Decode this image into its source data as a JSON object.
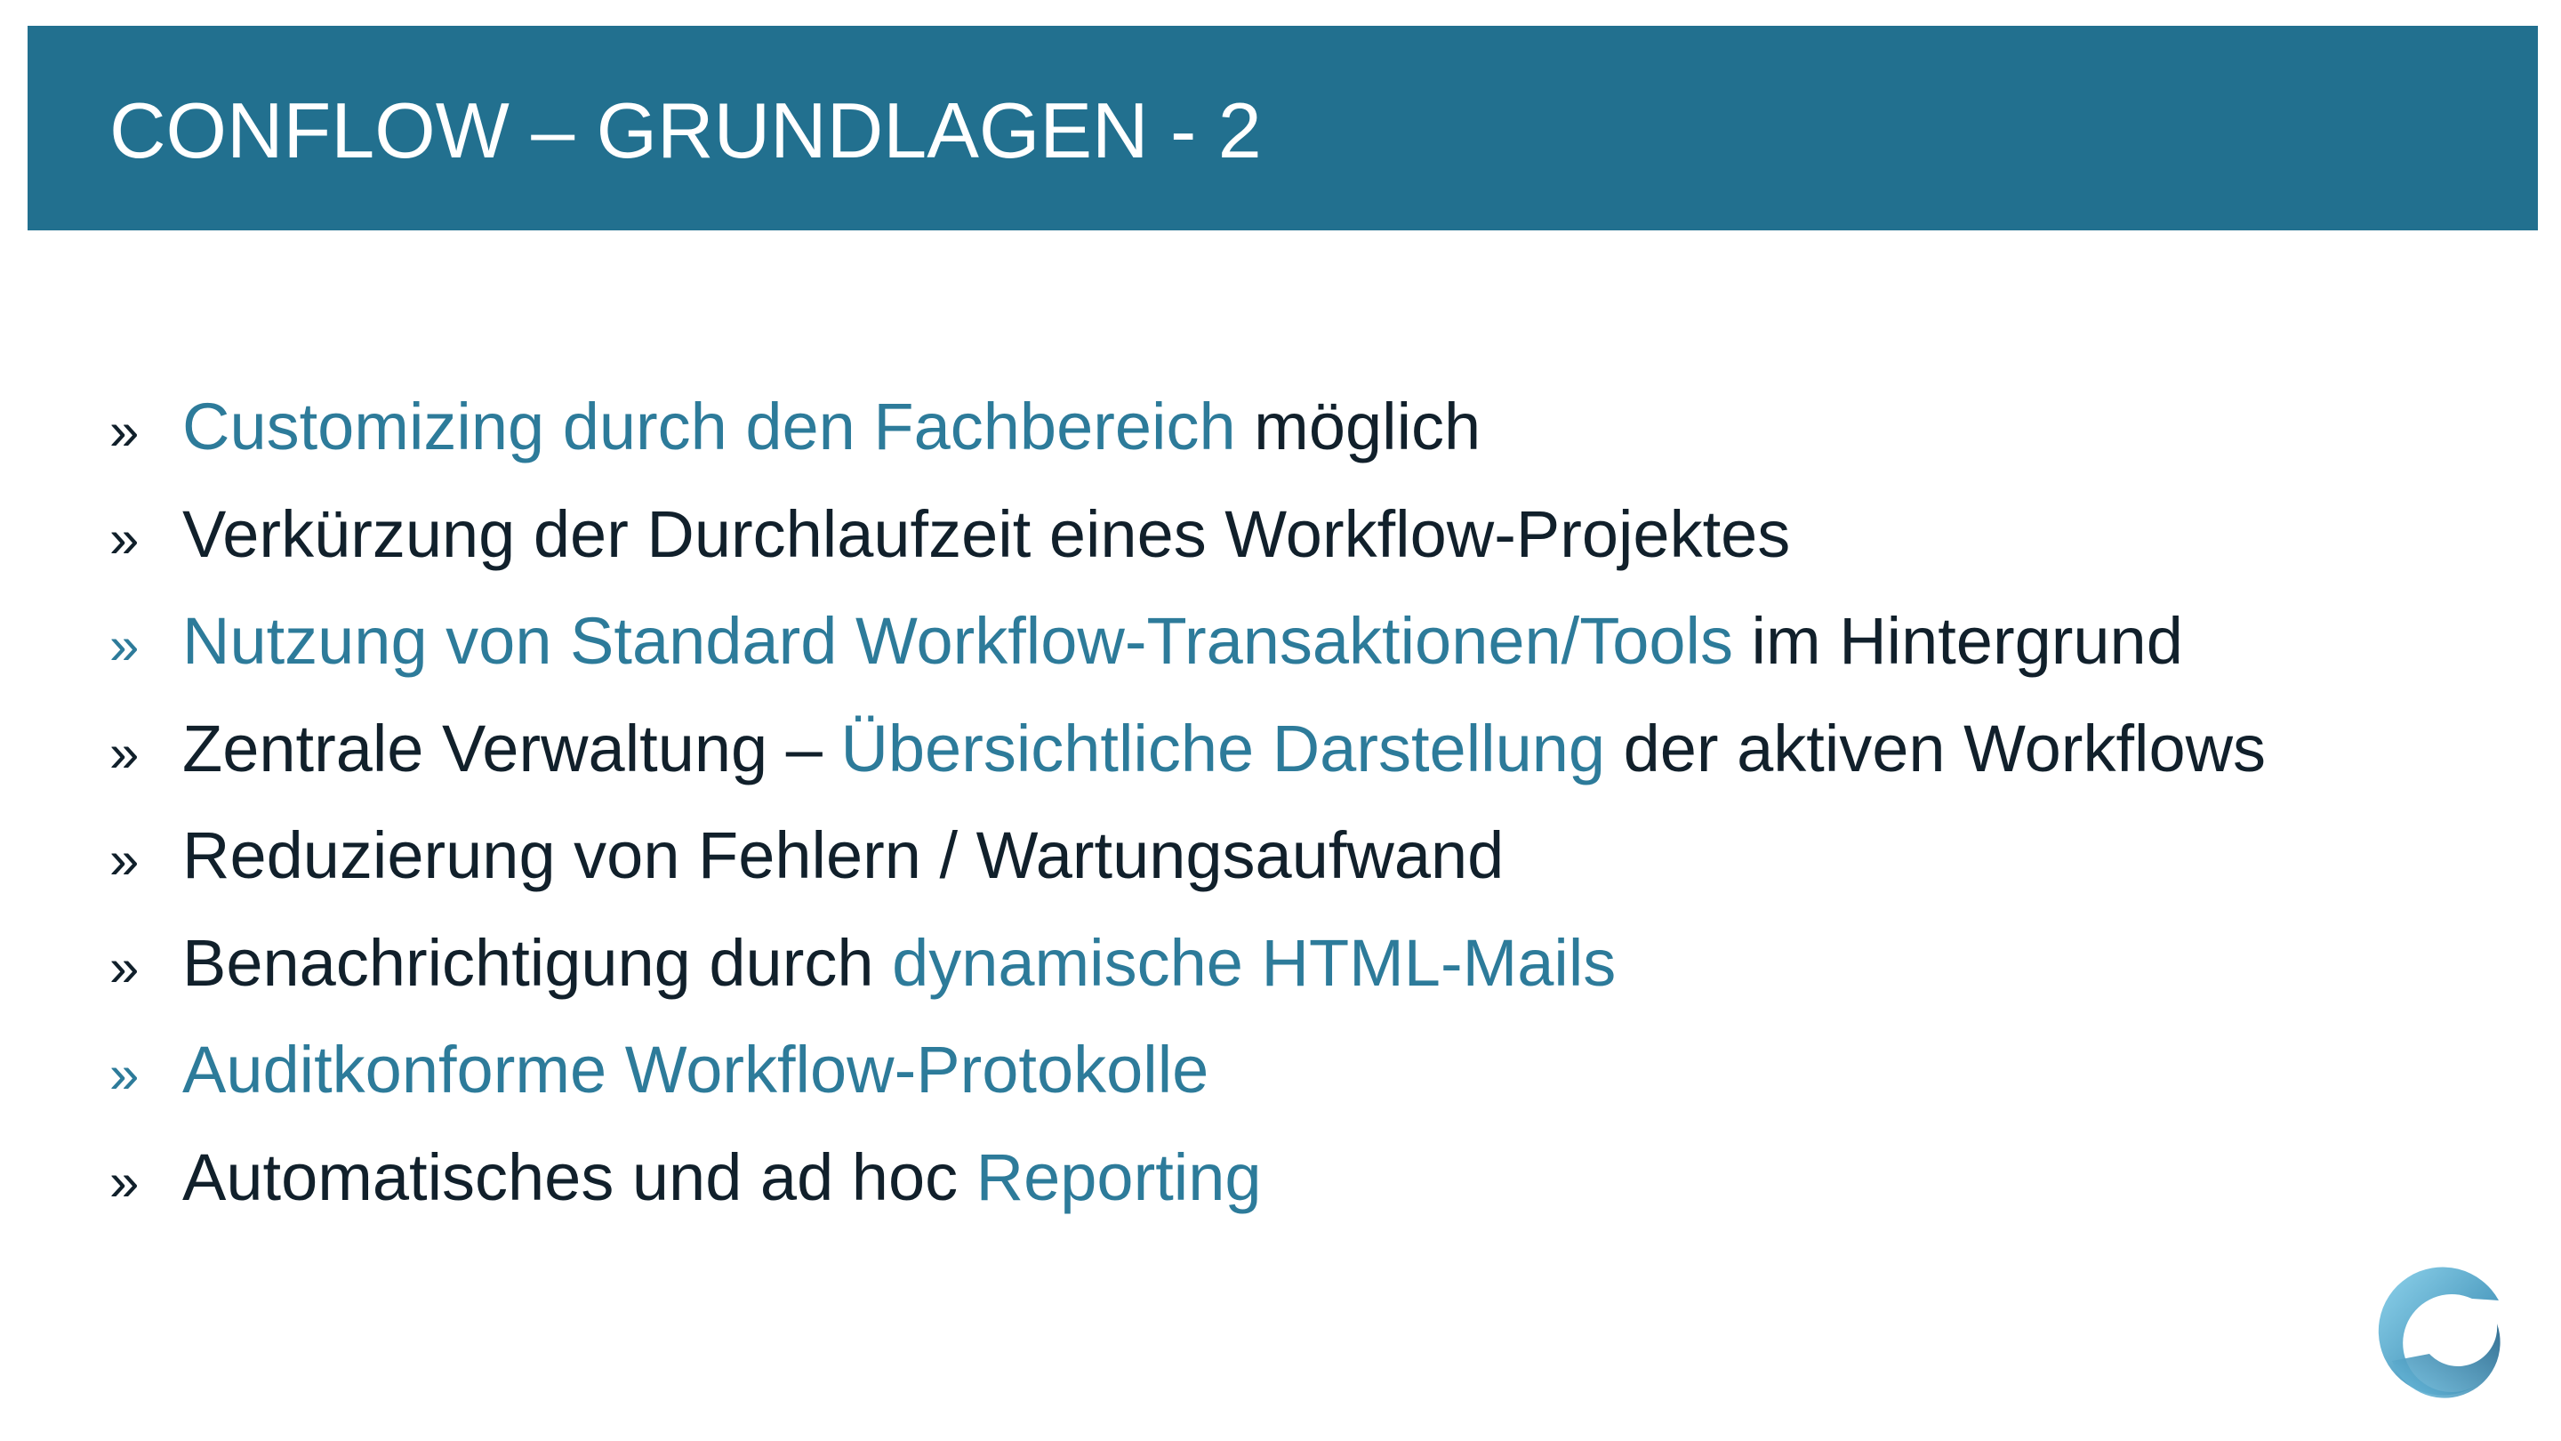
{
  "slide": {
    "title": "CONFLOW – GRUNDLAGEN - 2",
    "colors": {
      "title_bar": "#22708f",
      "accent_text": "#2d7b9a",
      "dark_text": "#11202b",
      "background": "#ffffff"
    },
    "bullet_marker": "»",
    "bullets": [
      {
        "marker_style": "dark",
        "segments": [
          {
            "text": "Customizing durch den Fachbereich",
            "style": "accent"
          },
          {
            "text": " möglich",
            "style": "dark"
          }
        ]
      },
      {
        "marker_style": "dark",
        "segments": [
          {
            "text": "Verkürzung der Durchlaufzeit eines Workflow-Projektes",
            "style": "dark"
          }
        ]
      },
      {
        "marker_style": "accent",
        "segments": [
          {
            "text": "Nutzung von Standard Workflow-Transaktionen/Tools",
            "style": "accent"
          },
          {
            "text": " im Hintergrund",
            "style": "dark"
          }
        ]
      },
      {
        "marker_style": "dark",
        "segments": [
          {
            "text": "Zentrale Verwaltung – ",
            "style": "dark"
          },
          {
            "text": "Übersichtliche Darstellung",
            "style": "accent"
          },
          {
            "text": " der aktiven Workflows",
            "style": "dark"
          }
        ]
      },
      {
        "marker_style": "dark",
        "segments": [
          {
            "text": "Reduzierung von Fehlern / Wartungsaufwand",
            "style": "dark"
          }
        ]
      },
      {
        "marker_style": "dark",
        "segments": [
          {
            "text": "Benachrichtigung durch ",
            "style": "dark"
          },
          {
            "text": "dynamische HTML-Mails",
            "style": "accent"
          }
        ]
      },
      {
        "marker_style": "accent",
        "segments": [
          {
            "text": "Auditkonforme Workflow-Protokolle",
            "style": "accent"
          }
        ]
      },
      {
        "marker_style": "dark",
        "segments": [
          {
            "text": "Automatisches und ad hoc ",
            "style": "dark"
          },
          {
            "text": "Reporting",
            "style": "accent"
          }
        ]
      }
    ],
    "logo_icon": "swirl-logo-icon"
  }
}
